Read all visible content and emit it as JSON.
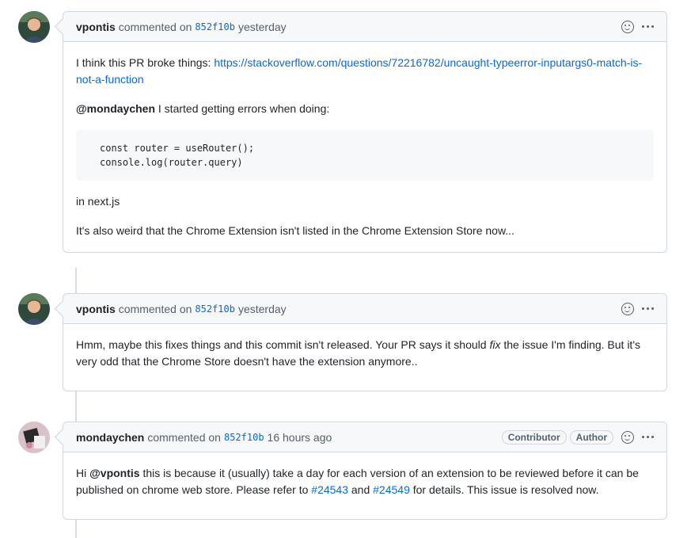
{
  "comments": [
    {
      "author": "vpontis",
      "action": "commented on",
      "sha": "852f10b",
      "time": "yesterday",
      "badges": [],
      "intro": "I think this PR broke things: ",
      "link": "https://stackoverflow.com/questions/72216782/uncaught-typeerror-inputargs0-match-is-not-a-function",
      "mention": "@mondaychen",
      "mention_text": " I started getting errors when doing:",
      "code": [
        "const router = useRouter();",
        "console.log(router.query)"
      ],
      "line3": "in next.js",
      "line4": "It's also weird that the Chrome Extension isn't listed in the Chrome Extension Store now..."
    },
    {
      "author": "vpontis",
      "action": "commented on",
      "sha": "852f10b",
      "time": "yesterday",
      "text_before": "Hmm, maybe this fixes things and this commit isn't released. Your PR says it should ",
      "text_em": "fix",
      "text_after": " the issue I'm finding. But it's very odd that the Chrome Store doesn't have the extension anymore.."
    },
    {
      "author": "mondaychen",
      "action": "commented on",
      "sha": "852f10b",
      "time": "16 hours ago",
      "badges": [
        "Contributor",
        "Author"
      ],
      "text_a": "Hi ",
      "mention": "@vpontis",
      "text_b": " this is because it (usually) take a day for each version of an extension to be reviewed before it can be published on chrome web store. Please refer to ",
      "ref1": "#24543",
      "text_c": " and ",
      "ref2": "#24549",
      "text_d": " for details. This issue is resolved now."
    }
  ],
  "icons": {
    "reaction": "smiley-icon",
    "menu": "kebab-horizontal-icon"
  },
  "colors": {
    "link": "#0969da",
    "border": "#d0d7de",
    "header_bg": "#f6f8fa"
  }
}
